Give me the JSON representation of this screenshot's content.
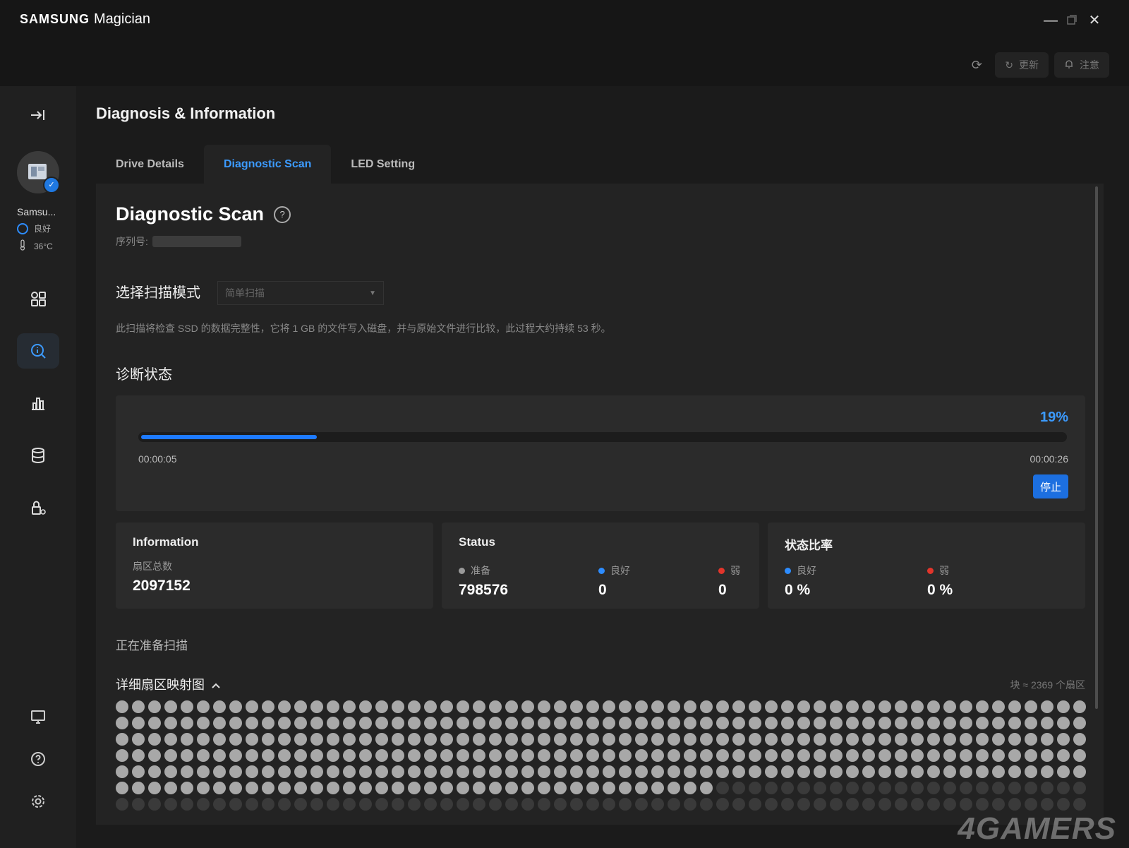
{
  "window": {
    "brand": "SAMSUNG",
    "app_name": "Magician",
    "refresh_icon": "refresh-icon",
    "update_label": "更新",
    "notice_label": "注意"
  },
  "sidebar": {
    "drive_name": "Samsu...",
    "drive_status": "良好",
    "drive_temp": "36°C",
    "nav_icons": [
      "collapse-icon",
      "dashboard-icon",
      "diagnosis-icon",
      "benchmark-icon",
      "data-management-icon",
      "security-icon",
      "display-icon",
      "help-icon",
      "settings-icon"
    ]
  },
  "page": {
    "title": "Diagnosis & Information",
    "tabs": [
      {
        "label": "Drive Details",
        "active": false
      },
      {
        "label": "Diagnostic Scan",
        "active": true
      },
      {
        "label": "LED Setting",
        "active": false
      }
    ]
  },
  "scan": {
    "title": "Diagnostic Scan",
    "serial_label": "序列号:",
    "mode_label": "选择扫描模式",
    "mode_value": "简单扫描",
    "description": "此扫描将检查 SSD 的数据完整性，它将 1 GB 的文件写入磁盘，并与原始文件进行比较，此过程大约持续 53 秒。",
    "status_label": "诊断状态",
    "progress_percent": 19,
    "progress_text": "19%",
    "elapsed": "00:00:05",
    "remaining": "00:00:26",
    "stop_label": "停止"
  },
  "information": {
    "title": "Information",
    "sectors_label": "扇区总数",
    "sectors_value": "2097152"
  },
  "status": {
    "title": "Status",
    "ready_label": "准备",
    "ready_value": "798576",
    "good_label": "良好",
    "good_value": "0",
    "weak_label": "弱",
    "weak_value": "0"
  },
  "ratio": {
    "title": "状态比率",
    "good_label": "良好",
    "good_value": "0 %",
    "weak_label": "弱",
    "weak_value": "0 %"
  },
  "map": {
    "preparing_text": "正在准备扫描",
    "title": "详细扇区映射图",
    "block_note": "块 ≈ 2369 个扇区",
    "processed_blocks": 337,
    "total_visible_blocks": 420
  },
  "colors": {
    "accent": "#3c9bff",
    "ready": "#9a9a9a",
    "good": "#2d8cff",
    "weak": "#e2352b",
    "sector_done": "#a8a8a8",
    "sector_pending": "#3a3a3a"
  },
  "watermark": "4GAMERS"
}
